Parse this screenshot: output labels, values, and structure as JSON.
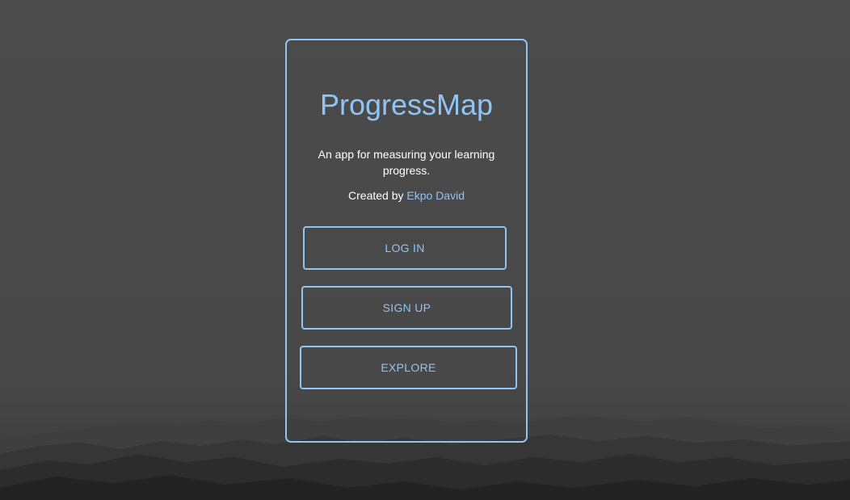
{
  "app": {
    "title": "ProgressMap",
    "tagline": "An app for measuring your learning progress.",
    "credit_prefix": "Created by ",
    "author": "Ekpo David"
  },
  "actions": {
    "login_label": "LOG IN",
    "signup_label": "SIGN UP",
    "explore_label": "EXPLORE"
  },
  "colors": {
    "accent": "#90c4f5",
    "background": "#4a4a4a",
    "text": "#ffffff"
  }
}
